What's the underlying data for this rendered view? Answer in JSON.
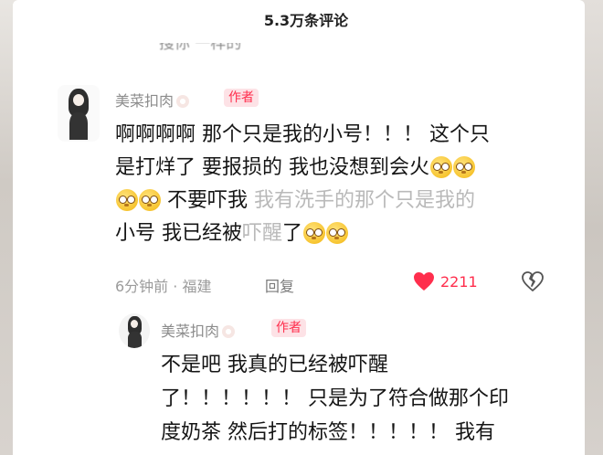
{
  "header": {
    "title": "5.3万条评论"
  },
  "previous_comment": {
    "fragment": "搜你 一样的"
  },
  "comment": {
    "username": "美菜扣肉",
    "badge": "作者",
    "lines": [
      "啊啊啊啊 那个只是我的小号！！！ 这个只",
      "是打烊了 要报损的 我也没想到会火",
      "不要吓我",
      "我有洗手的那个只是我的",
      "小号 我已经被",
      "吓醒",
      "了"
    ],
    "time_location": "6分钟前 · 福建",
    "reply_label": "回复",
    "like_count": "2211",
    "colors": {
      "accent": "#ff2e4d",
      "emoji": "#f7c531"
    }
  },
  "reply": {
    "username": "美菜扣肉",
    "badge": "作者",
    "lines": [
      "不是吧 我真的已经被吓醒",
      "了！！！！！！ 只是为了符合做那个印",
      "度奶茶 然后打的标签！！！！！ 我有"
    ]
  }
}
